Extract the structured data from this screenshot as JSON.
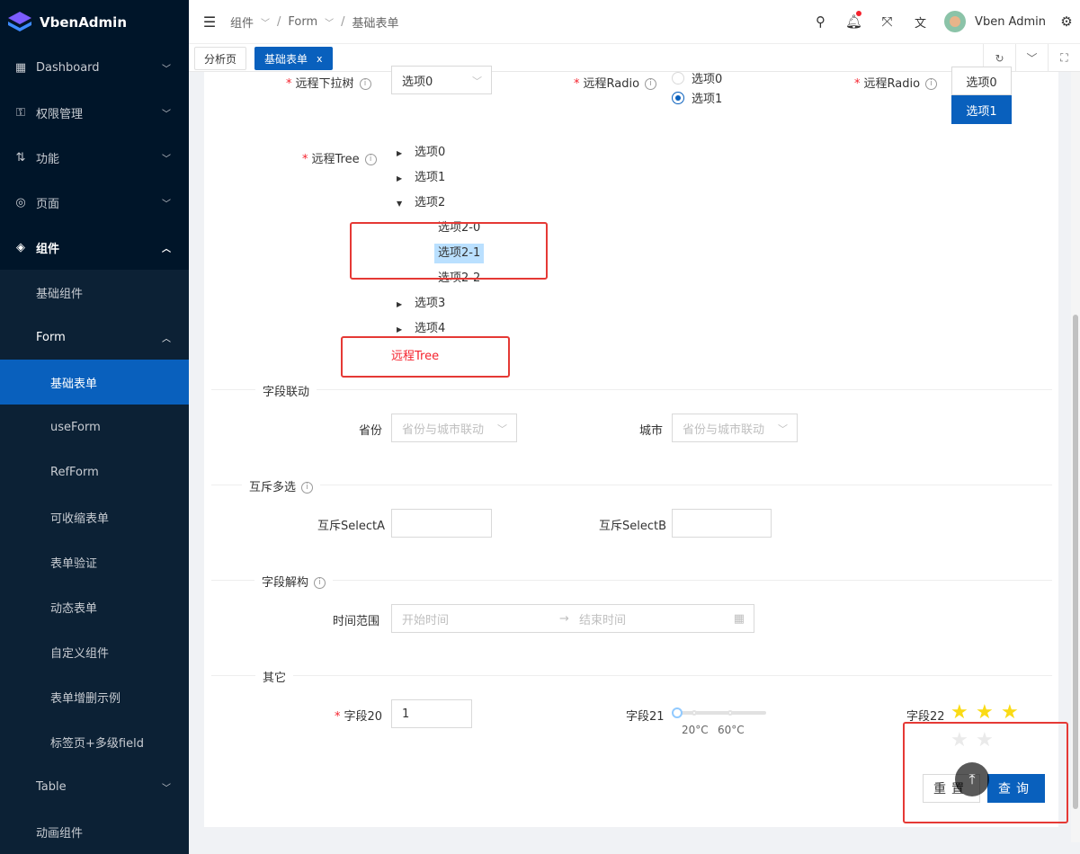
{
  "app": {
    "name": "VbenAdmin"
  },
  "sidebar": {
    "items": [
      {
        "label": "Dashboard"
      },
      {
        "label": "权限管理"
      },
      {
        "label": "功能"
      },
      {
        "label": "页面"
      },
      {
        "label": "组件"
      }
    ],
    "sub": [
      {
        "label": "基础组件"
      },
      {
        "label": "Form"
      }
    ],
    "form_sub": [
      {
        "label": "基础表单"
      },
      {
        "label": "useForm"
      },
      {
        "label": "RefForm"
      },
      {
        "label": "可收缩表单"
      },
      {
        "label": "表单验证"
      },
      {
        "label": "动态表单"
      },
      {
        "label": "自定义组件"
      },
      {
        "label": "表单增删示例"
      },
      {
        "label": "标签页+多级field"
      }
    ],
    "after": [
      {
        "label": "Table"
      },
      {
        "label": "动画组件"
      }
    ]
  },
  "header": {
    "breadcrumb": [
      "组件",
      "Form",
      "基础表单"
    ],
    "user": "Vben Admin"
  },
  "tabs": [
    {
      "label": "分析页"
    },
    {
      "label": "基础表单",
      "close": "x"
    }
  ],
  "form": {
    "remote_tree_select": {
      "label": "远程下拉树",
      "value": "选项0"
    },
    "remote_radio1": {
      "label": "远程Radio",
      "options": [
        "选项0",
        "选项1"
      ]
    },
    "remote_radio2": {
      "label": "远程Radio",
      "options": [
        "选项0",
        "选项1"
      ]
    },
    "remote_tree": {
      "label": "远程Tree",
      "nodes": [
        "选项0",
        "选项1",
        "选项2",
        "选项3",
        "选项4"
      ],
      "children": [
        "选项2-0",
        "选项2-1",
        "选项2-2"
      ],
      "error": "远程Tree"
    },
    "section_link": {
      "title": "字段联动"
    },
    "province": {
      "label": "省份",
      "placeholder": "省份与城市联动"
    },
    "city": {
      "label": "城市",
      "placeholder": "省份与城市联动"
    },
    "section_mutex": {
      "title": "互斥多选"
    },
    "selectA": {
      "label": "互斥SelectA"
    },
    "selectB": {
      "label": "互斥SelectB"
    },
    "section_struct": {
      "title": "字段解构"
    },
    "time_range": {
      "label": "时间范围",
      "start": "开始时间",
      "arrow": "→",
      "end": "结束时间"
    },
    "section_other": {
      "title": "其它"
    },
    "field20": {
      "label": "字段20",
      "value": "1"
    },
    "field21": {
      "label": "字段21",
      "marks": [
        "20°C",
        "60°C"
      ],
      "value": 0
    },
    "field22": {
      "label": "字段22",
      "rating": 3,
      "max": 5
    },
    "reset": "重置",
    "submit": "查询"
  },
  "colors": {
    "primary": "#0960bd",
    "sidebar": "#001529",
    "error": "#f5222d",
    "star": "#fadb14"
  }
}
